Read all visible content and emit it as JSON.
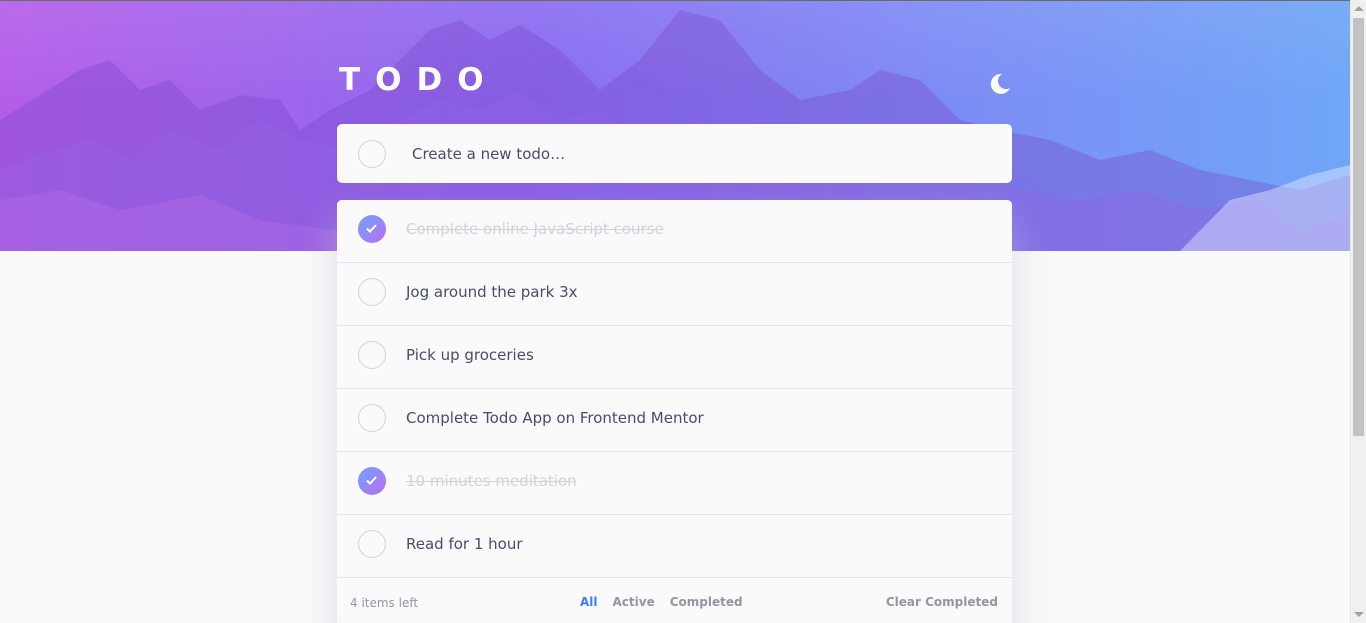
{
  "app": {
    "title": "TODO",
    "theme_icon": "moon-icon",
    "accent_color": "#3a7cfd"
  },
  "new_todo": {
    "placeholder": "Create a new todo…",
    "value": ""
  },
  "todos": [
    {
      "text": "Complete online JavaScript course",
      "completed": true
    },
    {
      "text": "Jog around the park 3x",
      "completed": false
    },
    {
      "text": "Pick up groceries",
      "completed": false
    },
    {
      "text": "Complete Todo App on Frontend Mentor",
      "completed": false
    },
    {
      "text": "10 minutes meditation",
      "completed": true
    },
    {
      "text": "Read for 1 hour",
      "completed": false
    }
  ],
  "footer": {
    "items_left": "4 items left",
    "filters": [
      "All",
      "Active",
      "Completed"
    ],
    "active_filter": "All",
    "clear_label": "Clear Completed"
  }
}
